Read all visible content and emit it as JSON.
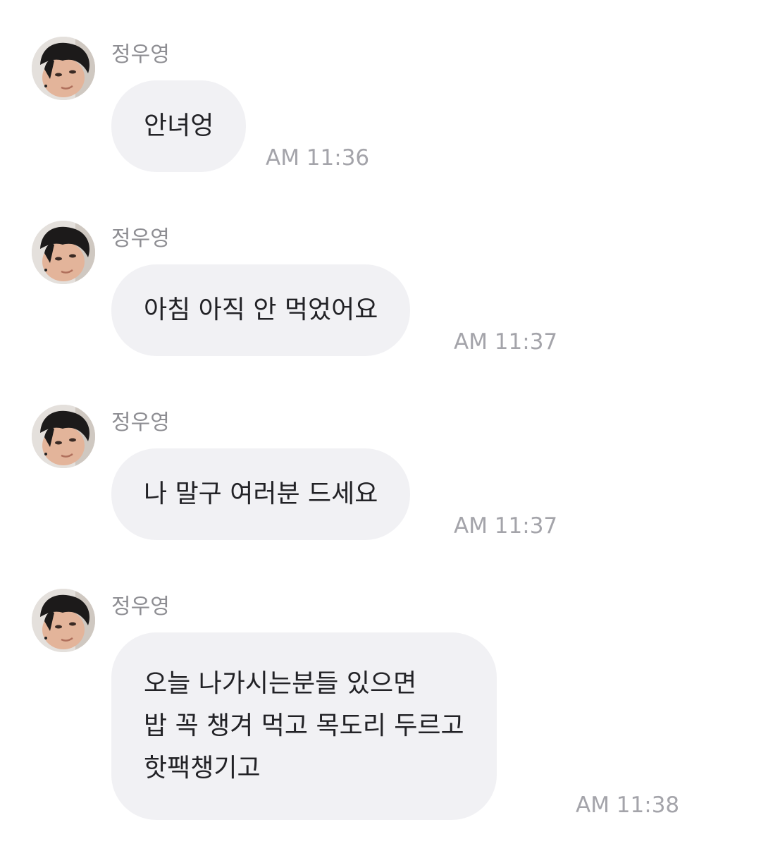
{
  "messages": [
    {
      "sender": "정우영",
      "lines": [
        "안녀엉"
      ],
      "time": "AM 11:36"
    },
    {
      "sender": "정우영",
      "lines": [
        "아침 아직 안 먹었어요"
      ],
      "time": "AM 11:37"
    },
    {
      "sender": "정우영",
      "lines": [
        "나 말구 여러분 드세요"
      ],
      "time": "AM 11:37"
    },
    {
      "sender": "정우영",
      "lines": [
        "오늘 나가시는분들 있으면",
        "밥 꼭 챙겨 먹고 목도리 두르고",
        "핫팩챙기고"
      ],
      "time": "AM 11:38"
    }
  ],
  "colors": {
    "background": "#ffffff",
    "bubble": "#f1f1f4",
    "message_text": "#222226",
    "sender_text": "#8e8e93",
    "time_text": "#a4a4aa"
  },
  "icons": {
    "avatar": "profile-photo"
  }
}
